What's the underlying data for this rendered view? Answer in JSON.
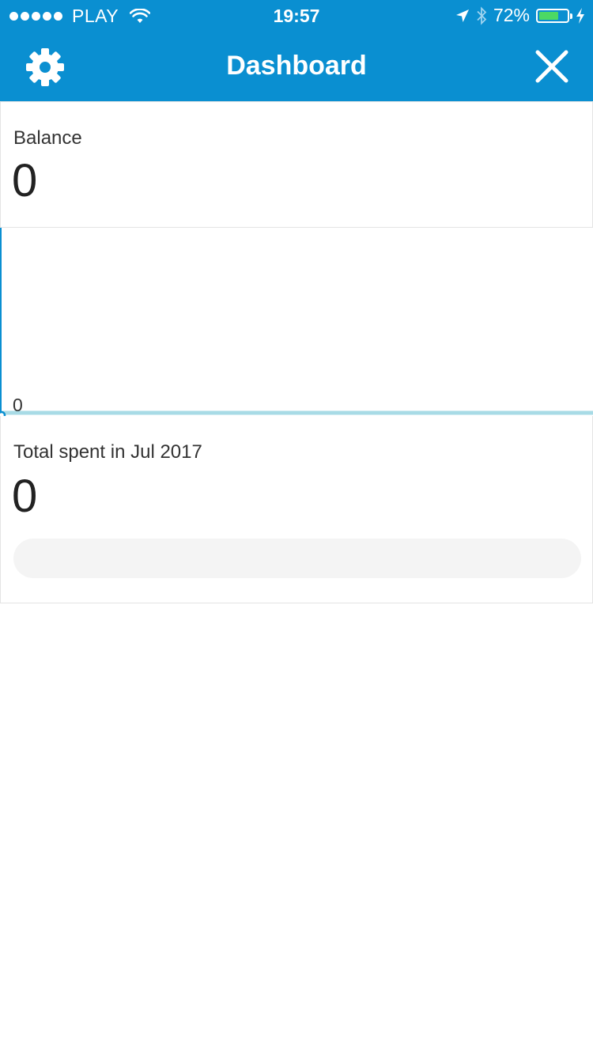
{
  "status_bar": {
    "carrier": "PLAY",
    "time": "19:57",
    "battery_percent": "72%",
    "battery_level": 0.72,
    "icons": [
      "signal-dots",
      "wifi-icon",
      "location-arrow-icon",
      "bluetooth-icon",
      "battery-icon",
      "charging-bolt-icon"
    ]
  },
  "nav": {
    "title": "Dashboard",
    "left_icon": "gear-icon",
    "right_icon": "close-icon"
  },
  "balance": {
    "label": "Balance",
    "value": "0"
  },
  "chart_data": {
    "type": "line",
    "x": [
      0
    ],
    "series": [
      {
        "values": [
          0
        ]
      }
    ],
    "tick_labels": [
      "0"
    ],
    "ylim": [
      0,
      0
    ]
  },
  "spent": {
    "label": "Total spent in Jul 2017",
    "value": "0",
    "progress": 0
  },
  "colors": {
    "primary": "#0a8fd1",
    "chart_line": "#a8dbe6",
    "battery_green": "#4cd964",
    "track": "#f4f4f4"
  }
}
